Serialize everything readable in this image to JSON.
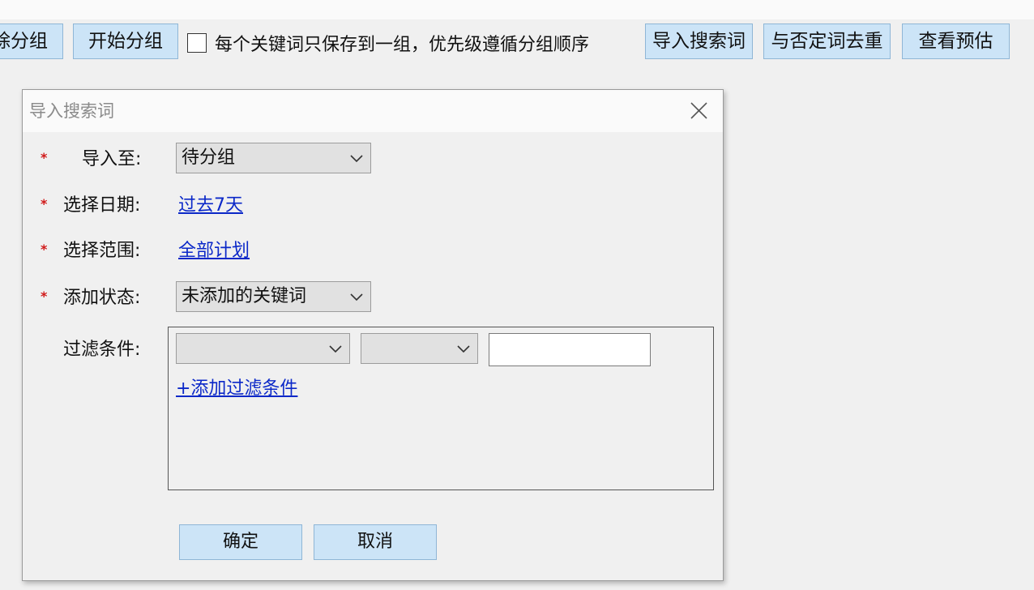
{
  "toolbar": {
    "buttons": [
      {
        "label": "移除分组"
      },
      {
        "label": "开始分组"
      },
      {
        "label": "导入搜索词"
      },
      {
        "label": "与否定词去重"
      },
      {
        "label": "查看预估"
      }
    ],
    "checkbox_label": "每个关键词只保存到一组，优先级遵循分组顺序",
    "checkbox_checked": false
  },
  "dialog": {
    "title": "导入搜索词",
    "required_mark": "*",
    "import_to": {
      "label": "导入至:",
      "value": "待分组"
    },
    "date": {
      "label": "选择日期:",
      "value": "过去7天"
    },
    "scope": {
      "label": "选择范围:",
      "value": "全部计划"
    },
    "status": {
      "label": "添加状态:",
      "value": "未添加的关键词"
    },
    "filter": {
      "label": "过滤条件:",
      "field_value": "",
      "operator_value": "",
      "input_value": "",
      "add_link": "+添加过滤条件"
    },
    "ok_label": "确定",
    "cancel_label": "取消"
  },
  "colors": {
    "button_bg": "#cce4f7",
    "link": "#0b28c8",
    "required": "#d01818"
  },
  "icons": {
    "close": "close-icon",
    "dropdown": "chevron-down-icon"
  }
}
